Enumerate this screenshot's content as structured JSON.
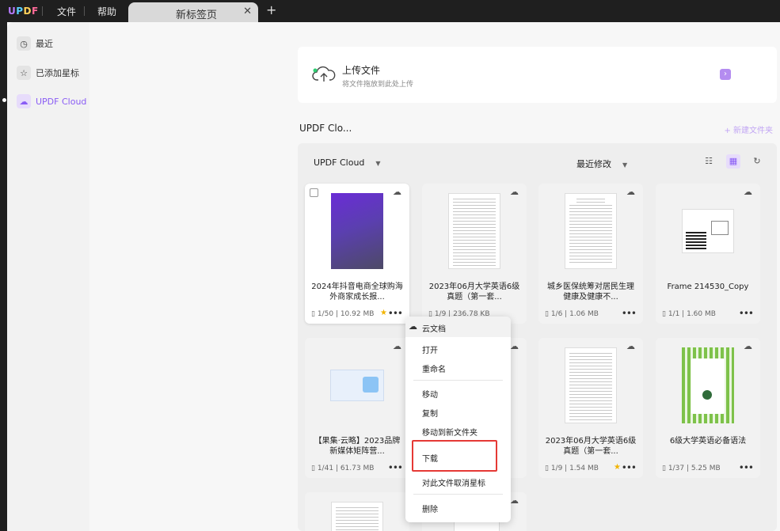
{
  "app": {
    "logo": [
      "U",
      "P",
      "D",
      "F"
    ],
    "menu": [
      "文件",
      "帮助"
    ],
    "tab_title": "新标签页",
    "tab_close": "✕",
    "tab_add": "+"
  },
  "sidebar": {
    "items": [
      {
        "label": "最近",
        "icon": "◷"
      },
      {
        "label": "已添加星标",
        "icon": "☆"
      },
      {
        "label": "UPDF Cloud",
        "icon": "☁"
      }
    ]
  },
  "upload": {
    "title": "上传文件",
    "subtitle": "将文件拖放到此处上传",
    "arrow": "›"
  },
  "section": {
    "title": "UPDF Clo...",
    "new_folder": "+ 新建文件夹"
  },
  "toolbar": {
    "location": "UPDF Cloud",
    "sort": "最近修改",
    "caret": "▼",
    "list_view": "☷",
    "grid_view": "▦",
    "refresh": "↻"
  },
  "cards": [
    {
      "name": "2024年抖音电商全球购海外商家成长报...",
      "pages": "1/50",
      "size": "10.92 MB",
      "starred": true
    },
    {
      "name": "2023年06月大学英语6级真题（第一套...",
      "pages": "1/9",
      "size": "236.78 KB",
      "starred": false
    },
    {
      "name": "城乡医保统筹对居民生理健康及健康不...",
      "pages": "1/6",
      "size": "1.06 MB",
      "starred": false
    },
    {
      "name": "Frame 214530_Copy",
      "pages": "1/1",
      "size": "1.60 MB",
      "starred": false
    },
    {
      "name": "【果集·云略】2023品牌新媒体矩阵营...",
      "pages": "1/41",
      "size": "61.73 MB",
      "starred": false
    },
    {
      "name": "",
      "pages": "",
      "size": "",
      "starred": false
    },
    {
      "name": "2023年06月大学英语6级真题（第一套...",
      "pages": "1/9",
      "size": "1.54 MB",
      "starred": true
    },
    {
      "name": "6级大学英语必备语法",
      "pages": "1/37",
      "size": "5.25 MB",
      "starred": false
    }
  ],
  "card_icons": {
    "cloud": "☁",
    "star": "★",
    "more": "•••",
    "page": "▯"
  },
  "context_menu": {
    "header": "云文档",
    "items": [
      "打开",
      "重命名",
      "移动",
      "复制",
      "移动到新文件夹",
      "下载",
      "对此文件取消星标",
      "删除"
    ],
    "highlighted": "下载",
    "highlight_color": "#e53935"
  },
  "colors": {
    "accent": "#8a5cf5",
    "titlebar": "#1f1f1f",
    "star": "#f2b400"
  }
}
